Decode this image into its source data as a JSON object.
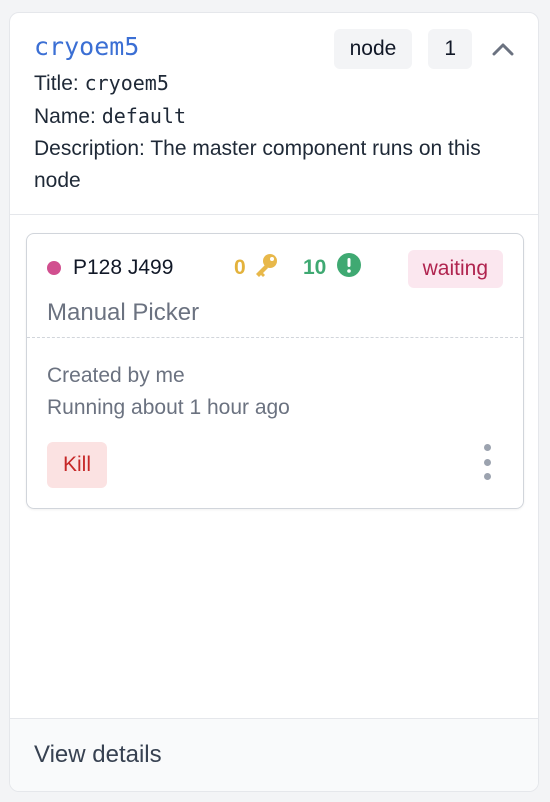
{
  "node": {
    "name": "cryoem5",
    "type_badge": "node",
    "count_badge": "1",
    "title_label": "Title:",
    "title_value": "cryoem5",
    "name_label": "Name:",
    "name_value": "default",
    "description_label": "Description:",
    "description_value": "The master component runs on this node"
  },
  "job": {
    "id": "P128 J499",
    "key_count": "0",
    "alert_count": "10",
    "status": "waiting",
    "name": "Manual Picker",
    "created": "Created by me",
    "running": "Running about 1 hour ago",
    "kill_label": "Kill"
  },
  "footer": {
    "view_details": "View details"
  },
  "colors": {
    "link": "#3b6fd4",
    "status_dot": "#d14f8f",
    "key_yellow": "#e3b23c",
    "alert_green": "#3fa972",
    "waiting_text": "#b0244f",
    "kill_text": "#c62828"
  },
  "icons": {
    "chevron": "chevron-up-icon",
    "key": "key-icon",
    "alert": "exclamation-circle-icon",
    "menu": "kebab-menu-icon"
  }
}
